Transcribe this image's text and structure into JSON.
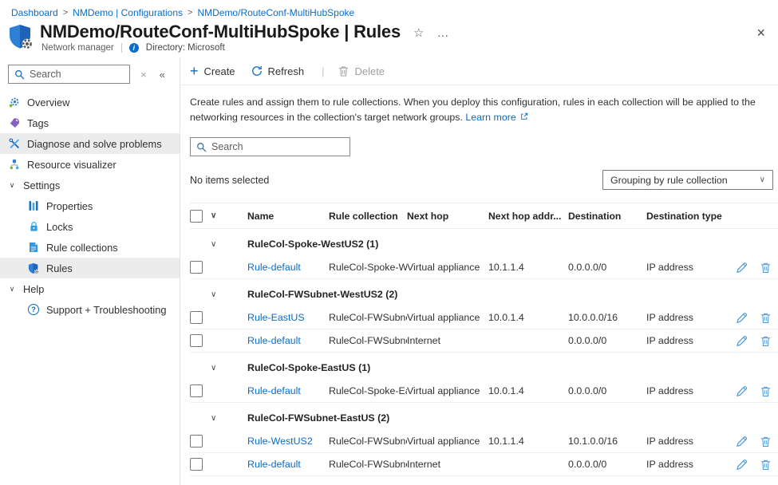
{
  "icons": {
    "breadcrumb_separator": ">",
    "star": "☆",
    "more": "…",
    "close": "×",
    "clear": "×",
    "sidebar_collapse": "«",
    "chevron_down": "∨",
    "info": "i"
  },
  "breadcrumb": {
    "items": [
      "Dashboard",
      "NMDemo | Configurations",
      "NMDemo/RouteConf-MultiHubSpoke"
    ]
  },
  "header": {
    "title": "NMDemo/RouteConf-MultiHubSpoke | Rules",
    "resource_type": "Network manager",
    "directory": "Directory: Microsoft"
  },
  "sidebar": {
    "search_placeholder": "Search",
    "items": [
      {
        "label": "Overview",
        "icon": "overview-icon"
      },
      {
        "label": "Tags",
        "icon": "tags-icon"
      },
      {
        "label": "Diagnose and solve problems",
        "icon": "diagnose-icon",
        "highlighted": true
      },
      {
        "label": "Resource visualizer",
        "icon": "resource-visualizer-icon"
      },
      {
        "label": "Settings",
        "section": true
      },
      {
        "label": "Properties",
        "icon": "properties-icon",
        "sub": true
      },
      {
        "label": "Locks",
        "icon": "locks-icon",
        "sub": true
      },
      {
        "label": "Rule collections",
        "icon": "rule-collections-icon",
        "sub": true
      },
      {
        "label": "Rules",
        "icon": "rules-icon",
        "sub": true,
        "selected": true
      },
      {
        "label": "Help",
        "section": true
      },
      {
        "label": "Support + Troubleshooting",
        "icon": "support-icon",
        "sub": true
      }
    ]
  },
  "toolbar": {
    "create_label": "Create",
    "refresh_label": "Refresh",
    "delete_label": "Delete",
    "delete_disabled": true
  },
  "description": {
    "text": "Create rules and assign them to rule collections. When you deploy this configuration, rules in each collection will be applied to the networking resources in the collection's target network groups.",
    "link_label": "Learn more"
  },
  "list": {
    "search_placeholder": "Search",
    "selection_status": "No items selected",
    "grouping_label": "Grouping by rule collection",
    "columns": [
      "Name",
      "Rule collection",
      "Next hop",
      "Next hop addr...",
      "Destination",
      "Destination type"
    ],
    "groups": [
      {
        "label": "RuleCol-Spoke-WestUS2 (1)",
        "rows": [
          {
            "name": "Rule-default",
            "collection": "RuleCol-Spoke-We",
            "next_hop": "Virtual appliance",
            "next_hop_address": "10.1.1.4",
            "destination": "0.0.0.0/0",
            "destination_type": "IP address"
          }
        ]
      },
      {
        "label": "RuleCol-FWSubnet-WestUS2 (2)",
        "rows": [
          {
            "name": "Rule-EastUS",
            "collection": "RuleCol-FWSubnet",
            "next_hop": "Virtual appliance",
            "next_hop_address": "10.0.1.4",
            "destination": "10.0.0.0/16",
            "destination_type": "IP address"
          },
          {
            "name": "Rule-default",
            "collection": "RuleCol-FWSubnet",
            "next_hop": "Internet",
            "next_hop_address": "",
            "destination": "0.0.0.0/0",
            "destination_type": "IP address"
          }
        ]
      },
      {
        "label": "RuleCol-Spoke-EastUS (1)",
        "rows": [
          {
            "name": "Rule-default",
            "collection": "RuleCol-Spoke-Eas",
            "next_hop": "Virtual appliance",
            "next_hop_address": "10.0.1.4",
            "destination": "0.0.0.0/0",
            "destination_type": "IP address"
          }
        ]
      },
      {
        "label": "RuleCol-FWSubnet-EastUS (2)",
        "rows": [
          {
            "name": "Rule-WestUS2",
            "collection": "RuleCol-FWSubnet",
            "next_hop": "Virtual appliance",
            "next_hop_address": "10.1.1.4",
            "destination": "10.1.0.0/16",
            "destination_type": "IP address"
          },
          {
            "name": "Rule-default",
            "collection": "RuleCol-FWSubnet",
            "next_hop": "Internet",
            "next_hop_address": "",
            "destination": "0.0.0.0/0",
            "destination_type": "IP address"
          }
        ]
      }
    ]
  },
  "colors": {
    "accent": "#0a6ccb",
    "link": "#0a6ccb",
    "action_icon": "#4a98d9",
    "selected_bg": "#ececec"
  }
}
